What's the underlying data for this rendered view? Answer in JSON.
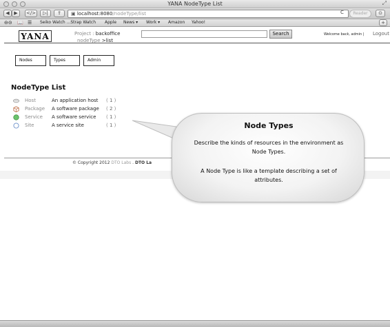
{
  "window": {
    "title": "YANA NodeType List"
  },
  "toolbar": {
    "back_glyph": "◀",
    "forward_glyph": "▶",
    "code_glyph": "</>",
    "code2_glyph": "▷|",
    "share_glyph": "⇪",
    "url_host": "localhost:8080",
    "url_path": "/nodeType/list",
    "reload_glyph": "C",
    "reader_label": "Reader",
    "download_glyph": "⊙",
    "add_glyph": "+"
  },
  "bookmarks": {
    "items": [
      "Seiko Watch ...Strap Watch",
      "Apple",
      "News ▾",
      "Work ▾",
      "Amazon",
      "Yahoo!"
    ]
  },
  "header": {
    "logo": "YANA",
    "project_label": "Project :",
    "project_value": "backoffice",
    "crumb_label": "nodeType",
    "crumb_value": ">list",
    "search_button": "Search",
    "welcome": "Welcome back, admin |",
    "logout": "Logout"
  },
  "nav": {
    "items": [
      "Nodes",
      "Types",
      "Admin"
    ]
  },
  "list": {
    "title": "NodeType List",
    "rows": [
      {
        "name": "Host",
        "description": "An application host",
        "count_open": "(",
        "count": "1",
        "count_close": ")",
        "icon": "host-icon",
        "color": "#9a9a9a"
      },
      {
        "name": "Package",
        "description": "A software package",
        "count_open": "(",
        "count": "2",
        "count_close": ")",
        "icon": "package-icon",
        "color": "#c0704a"
      },
      {
        "name": "Service",
        "description": "A software service",
        "count_open": "(",
        "count": "1",
        "count_close": ")",
        "icon": "service-icon",
        "color": "#5cb85c"
      },
      {
        "name": "Site",
        "description": "A service site",
        "count_open": "(",
        "count": "1",
        "count_close": ")",
        "icon": "site-icon",
        "color": "#6a8fc9"
      }
    ]
  },
  "footer": {
    "copyright": "© Copyright 2012",
    "link": "DTO Labs",
    "sep": ".",
    "link2": "DTO La"
  },
  "bubble": {
    "title": "Node Types",
    "line1": "Describe the kinds of resources in the environment as Node Types.",
    "line2": "A Node Type is like a template describing a set of attributes."
  }
}
